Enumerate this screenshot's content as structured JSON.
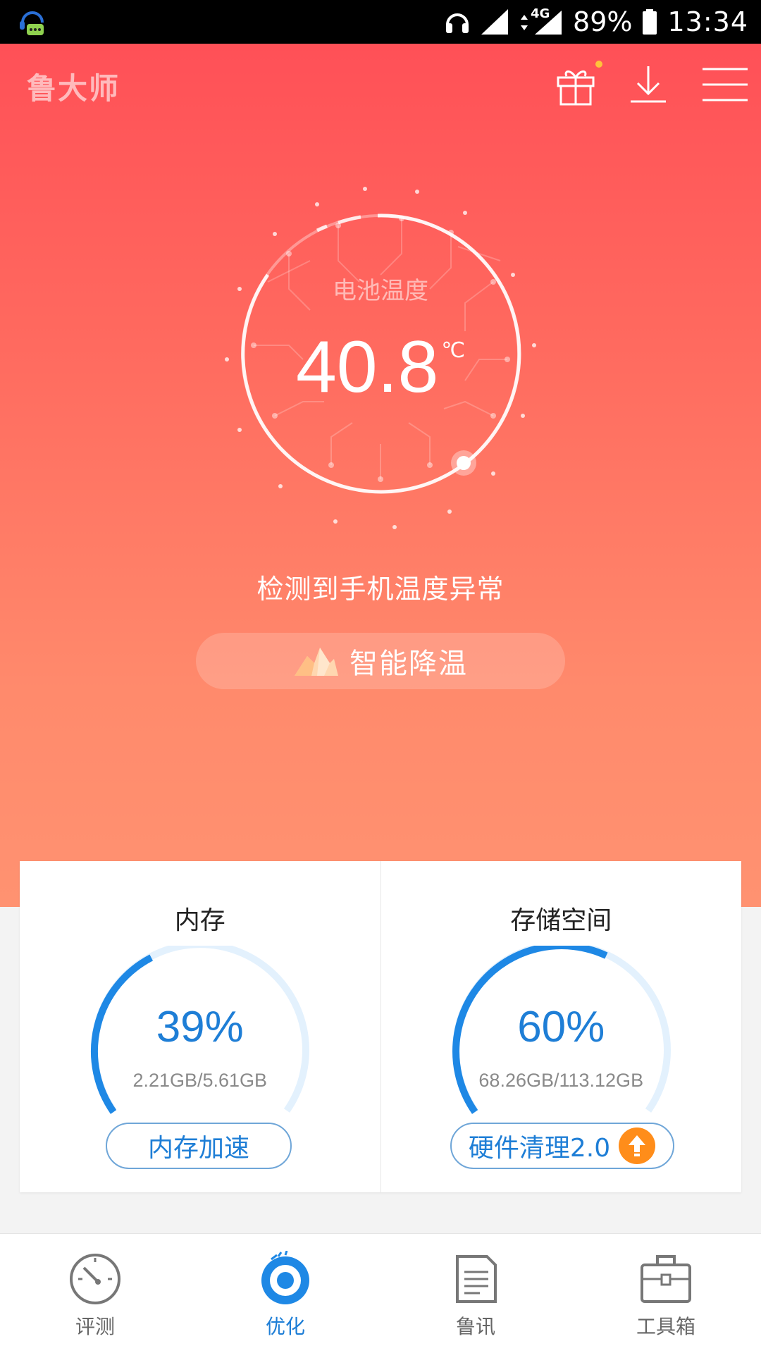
{
  "status_bar": {
    "network": "4G",
    "battery": "89%",
    "time": "13:34"
  },
  "header": {
    "app_title": "鲁大师",
    "icons": [
      "gift-icon",
      "download-icon",
      "menu-icon"
    ]
  },
  "battery_gauge": {
    "label": "电池温度",
    "temperature": "40.8",
    "unit": "℃",
    "warning": "检测到手机温度异常",
    "action_label": "智能降温"
  },
  "memory": {
    "title": "内存",
    "percent_text": "39%",
    "percent": 39,
    "detail": "2.21GB/5.61GB",
    "action_label": "内存加速"
  },
  "storage": {
    "title": "存储空间",
    "percent_text": "60%",
    "percent": 60,
    "detail": "68.26GB/113.12GB",
    "action_label": "硬件清理2.0"
  },
  "bottom_nav": {
    "items": [
      {
        "label": "评测",
        "icon": "gauge-icon",
        "active": false
      },
      {
        "label": "优化",
        "icon": "optimize-icon",
        "active": true
      },
      {
        "label": "鲁讯",
        "icon": "news-icon",
        "active": false
      },
      {
        "label": "工具箱",
        "icon": "toolbox-icon",
        "active": false
      }
    ]
  },
  "colors": {
    "accent": "#1e7ed6",
    "hero_top": "#ff5057",
    "hero_bottom": "#ff9271",
    "badge": "#ff8d1a"
  }
}
